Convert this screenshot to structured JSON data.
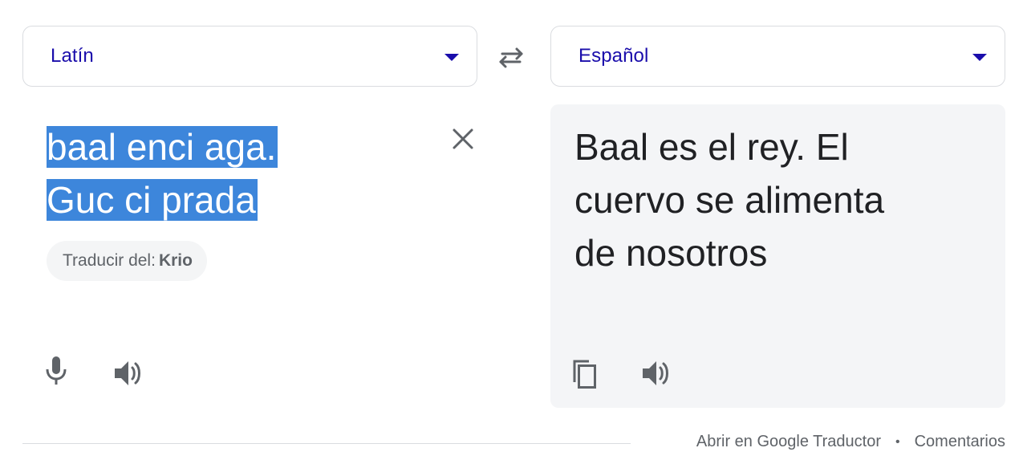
{
  "source_lang": {
    "label": "Latín",
    "caret_icon": "caret-down-icon"
  },
  "target_lang": {
    "label": "Español",
    "caret_icon": "caret-down-icon"
  },
  "swap": {
    "icon": "swap-arrows-icon"
  },
  "source": {
    "lines": [
      "baal enci aga.",
      "Guc ci prada"
    ],
    "clear_icon": "close-icon",
    "detect_prefix": "Traducir del:",
    "detect_lang": "Krio",
    "mic_icon": "microphone-icon",
    "listen_icon": "speaker-icon"
  },
  "target": {
    "lines": [
      "Baal es el rey. El",
      "cuervo se alimenta",
      "de nosotros"
    ],
    "copy_icon": "copy-icon",
    "listen_icon": "speaker-icon"
  },
  "footer": {
    "open_link": "Abrir en Google Traductor",
    "separator": "•",
    "feedback_link": "Comentarios"
  },
  "colors": {
    "accent": "#1a0dab",
    "highlight": "#3d86db",
    "muted": "#5f6368",
    "panel": "#f4f5f7"
  }
}
